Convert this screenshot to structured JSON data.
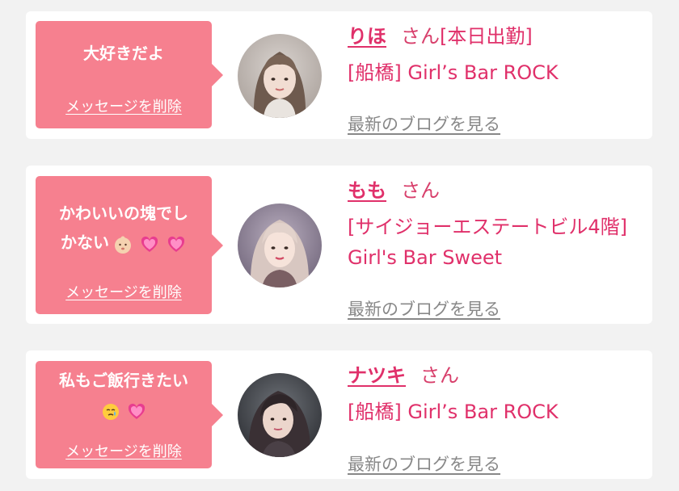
{
  "messages": [
    {
      "text": "大好きだよ",
      "emoji": [],
      "delete_label": "メッセージを削除",
      "avatar": "girl-portrait-1",
      "name": "りほ",
      "honorific": "さん",
      "status": "[本日出勤]",
      "store": "[船橋] Girl’s Bar ROCK",
      "blog_label": "最新のブログを見る"
    },
    {
      "text_line1": "かわいいの塊でし",
      "text_line2": "かない",
      "emoji": [
        "baby-face-emoji",
        "pink-heart-emoji",
        "pink-heart-emoji"
      ],
      "delete_label": "メッセージを削除",
      "avatar": "girl-portrait-2",
      "name": "もも",
      "honorific": "さん",
      "store": "[サイジョーエステートビル4階] Girl's Bar Sweet",
      "blog_label": "最新のブログを見る"
    },
    {
      "text_line1": "私もご飯行きたい",
      "emoji": [
        "crying-face-emoji",
        "pink-heart-emoji"
      ],
      "delete_label": "メッセージを削除",
      "avatar": "girl-portrait-3",
      "name": "ナツキ",
      "honorific": "さん",
      "store": "[船橋] Girl’s Bar ROCK",
      "blog_label": "最新のブログを見る"
    }
  ],
  "colors": {
    "bubble": "#f6808f",
    "accent": "#e0306a",
    "link_gray": "#888888",
    "background": "#f2f2f2"
  }
}
